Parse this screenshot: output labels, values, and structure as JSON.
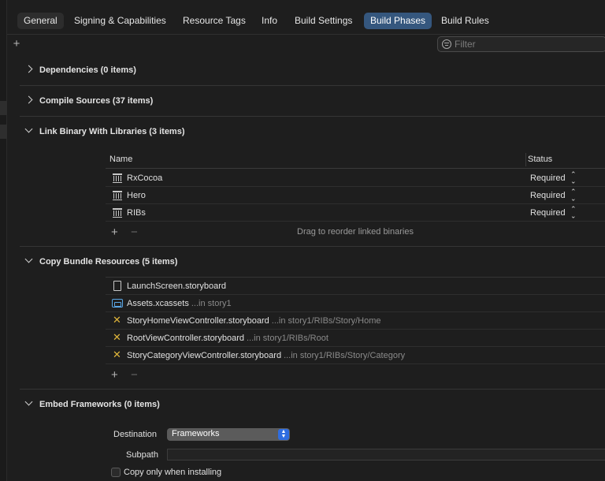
{
  "tabs": [
    {
      "label": "General"
    },
    {
      "label": "Signing & Capabilities"
    },
    {
      "label": "Resource Tags"
    },
    {
      "label": "Info"
    },
    {
      "label": "Build Settings"
    },
    {
      "label": "Build Phases",
      "active": true
    },
    {
      "label": "Build Rules"
    }
  ],
  "toolbar": {
    "add_label": "+",
    "filter_placeholder": "Filter"
  },
  "sections": {
    "dependencies": {
      "title": "Dependencies (0 items)",
      "expanded": false
    },
    "compile_sources": {
      "title": "Compile Sources (37 items)",
      "expanded": false
    },
    "link_binary": {
      "title": "Link Binary With Libraries (3 items)",
      "expanded": true,
      "columns": {
        "name": "Name",
        "status": "Status"
      },
      "rows": [
        {
          "name": "RxCocoa",
          "status": "Required",
          "icon": "library-icon"
        },
        {
          "name": "Hero",
          "status": "Required",
          "icon": "library-icon"
        },
        {
          "name": "RIBs",
          "status": "Required",
          "icon": "library-icon"
        }
      ],
      "add_label": "+",
      "remove_label": "−",
      "hint": "Drag to reorder linked binaries"
    },
    "copy_bundle": {
      "title": "Copy Bundle Resources (5 items)",
      "expanded": true,
      "rows": [
        {
          "name": "LaunchScreen.storyboard",
          "path": "",
          "icon": "file-icon"
        },
        {
          "name": "Assets.xcassets",
          "path": "...in story1",
          "icon": "asset-catalog-icon"
        },
        {
          "name": "StoryHomeViewController.storyboard",
          "path": "...in story1/RIBs/Story/Home",
          "icon": "storyboard-icon"
        },
        {
          "name": "RootViewController.storyboard",
          "path": "...in story1/RIBs/Root",
          "icon": "storyboard-icon"
        },
        {
          "name": "StoryCategoryViewController.storyboard",
          "path": "...in story1/RIBs/Story/Category",
          "icon": "storyboard-icon"
        }
      ],
      "add_label": "+",
      "remove_label": "−"
    },
    "embed_frameworks": {
      "title": "Embed Frameworks (0 items)",
      "expanded": true,
      "destination_label": "Destination",
      "destination_value": "Frameworks",
      "subpath_label": "Subpath",
      "subpath_value": "",
      "copy_only_label": "Copy only when installing",
      "copy_only_checked": false
    }
  },
  "colors": {
    "accent": "#35577e",
    "popup_arrows": "#2f6de0",
    "storyboard": "#e0b63b",
    "assets": "#5aa7e6"
  }
}
